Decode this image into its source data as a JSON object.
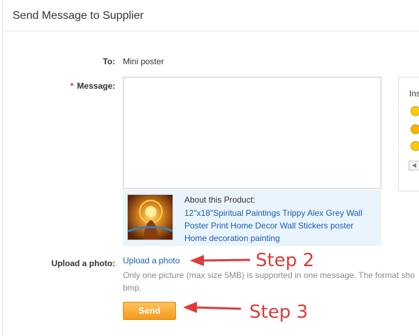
{
  "dialog": {
    "title": "Send Message to Supplier"
  },
  "form": {
    "to_label": "To:",
    "to_value": "Mini poster",
    "required_mark": "*",
    "message_label": "Message:",
    "message_value": "",
    "upload_label": "Upload a photo:"
  },
  "emoji_panel": {
    "header": "Ins",
    "icons": [
      "smile-icon",
      "laugh-icon",
      "wink-icon"
    ]
  },
  "product": {
    "about_label": "About this Product:",
    "name": "12\"x18\"Spiritual Paintings Trippy Alex Grey Wall Poster Print Home Decor Wall Stickers poster Home decoration painting"
  },
  "upload": {
    "link_text": "Upload a photo",
    "hint_line1": "Only one picture (max size 5MB) is supported in one message. The format sho",
    "hint_line2": "bmp."
  },
  "send_button": {
    "label": "Send"
  },
  "annotations": {
    "step2": "Step 2",
    "step3": "Step 3",
    "color": "#e03a3a"
  },
  "colors": {
    "link": "#1a5cb8",
    "accent": "#f39a1b",
    "panel_bg": "#eaf4fc"
  }
}
